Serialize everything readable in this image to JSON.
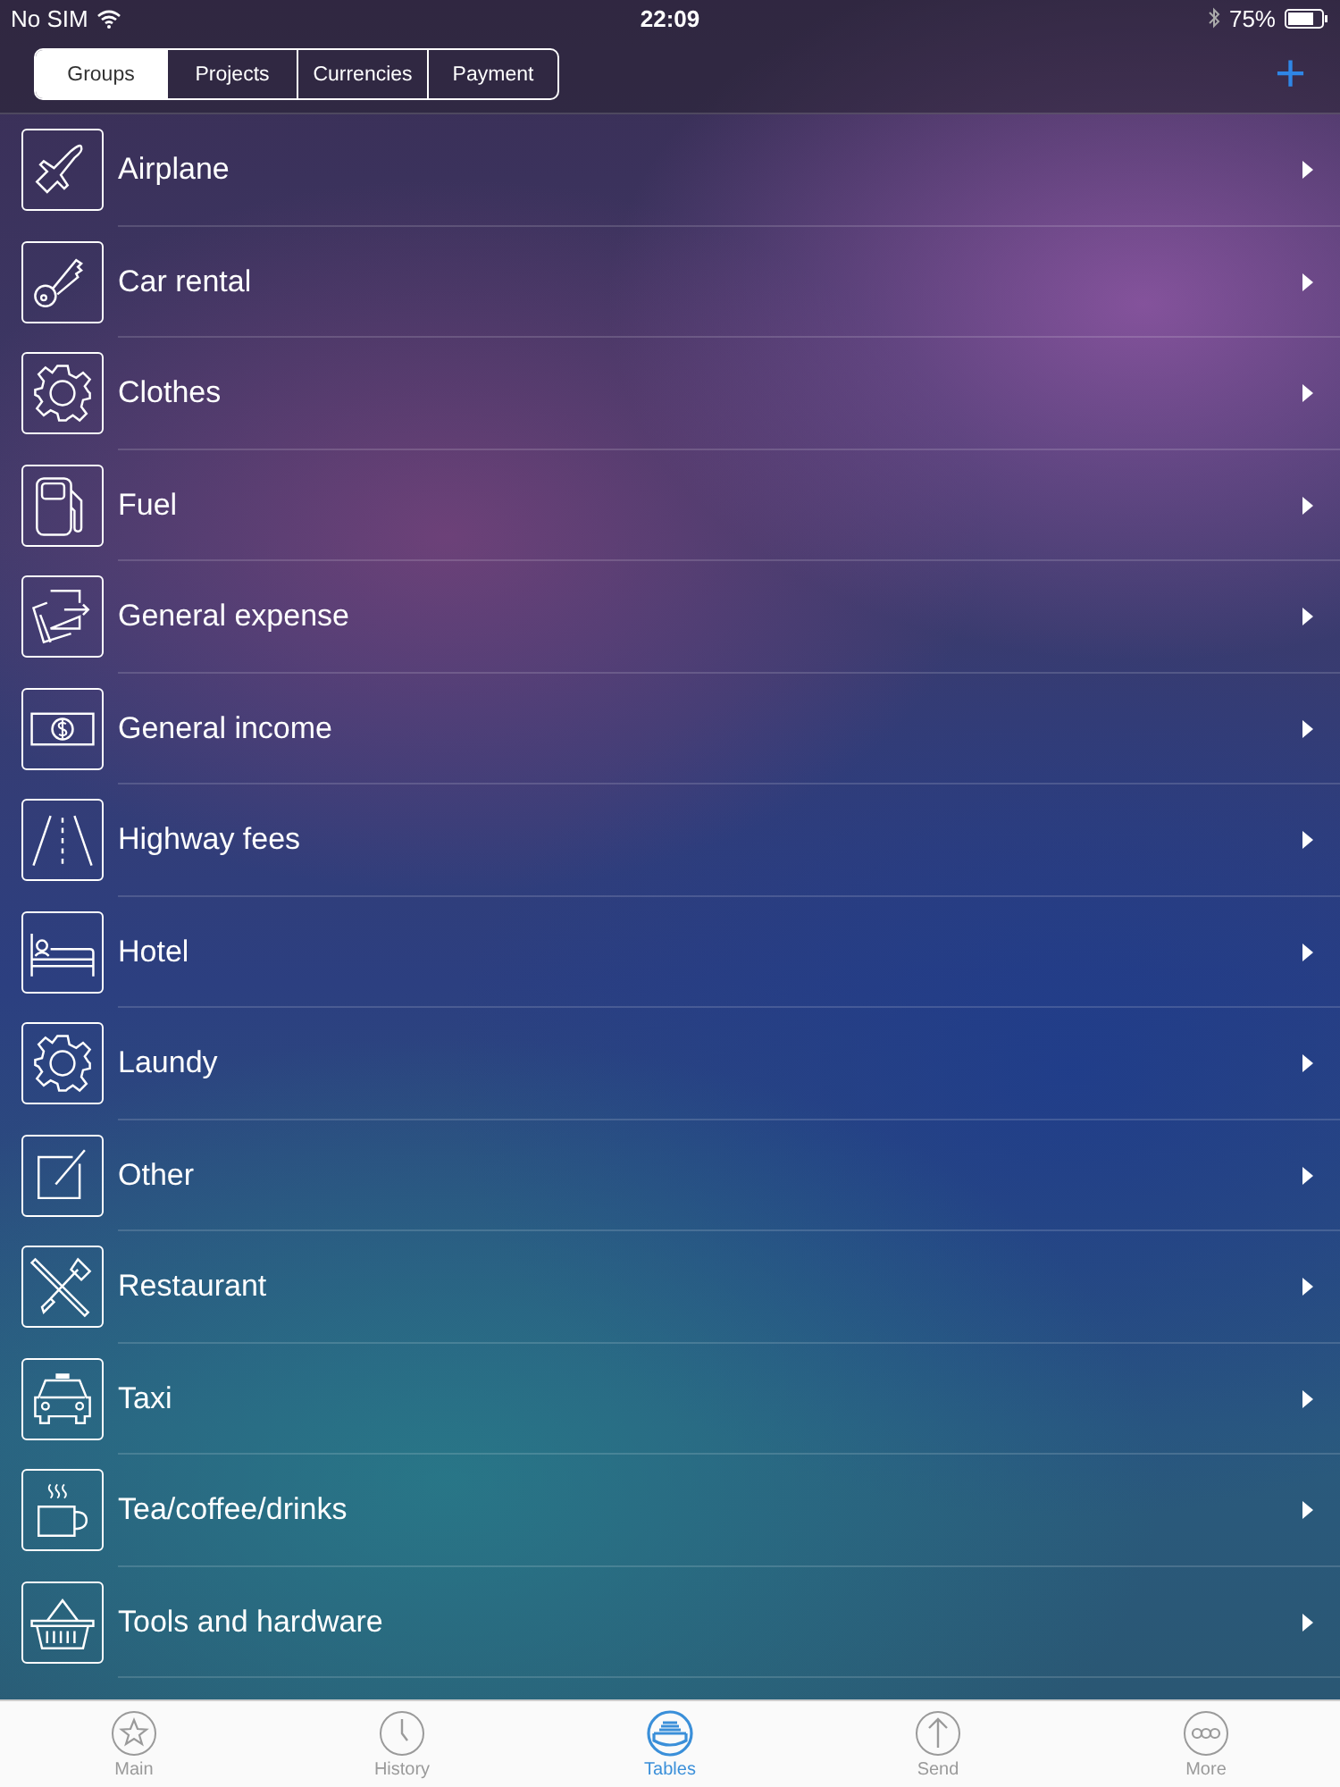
{
  "status_bar": {
    "carrier": "No SIM",
    "time": "22:09",
    "battery": "75%"
  },
  "segments": [
    {
      "label": "Groups",
      "selected": true
    },
    {
      "label": "Projects",
      "selected": false
    },
    {
      "label": "Currencies",
      "selected": false
    },
    {
      "label": "Payment",
      "selected": false
    }
  ],
  "add_button": "+",
  "groups": [
    {
      "label": "Airplane"
    },
    {
      "label": "Car rental"
    },
    {
      "label": "Clothes"
    },
    {
      "label": "Fuel"
    },
    {
      "label": "General expense"
    },
    {
      "label": "General income"
    },
    {
      "label": "Highway fees"
    },
    {
      "label": "Hotel"
    },
    {
      "label": "Laundy"
    },
    {
      "label": "Other"
    },
    {
      "label": "Restaurant"
    },
    {
      "label": "Taxi"
    },
    {
      "label": "Tea/coffee/drinks"
    },
    {
      "label": "Tools and hardware"
    }
  ],
  "tab_bar": [
    {
      "label": "Main",
      "selected": false
    },
    {
      "label": "History",
      "selected": false
    },
    {
      "label": "Tables",
      "selected": true
    },
    {
      "label": "Send",
      "selected": false
    },
    {
      "label": "More",
      "selected": false
    }
  ]
}
